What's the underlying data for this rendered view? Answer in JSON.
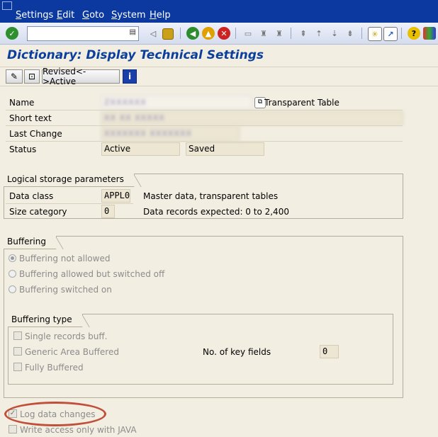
{
  "menu": {
    "items": [
      "Settings",
      "Edit",
      "Goto",
      "System",
      "Help"
    ],
    "accents": [
      "S",
      "E",
      "G",
      "S",
      "H"
    ]
  },
  "toolbar": {
    "command_field_value": "",
    "icons": [
      "enter-icon",
      "command-history-icon",
      "back-arrow-icon",
      "save-icon",
      "back-icon",
      "exit-icon",
      "cancel-icon",
      "print-icon",
      "find-icon",
      "find-next-icon",
      "first-page-icon",
      "previous-page-icon",
      "next-page-icon",
      "last-page-icon",
      "create-session-icon",
      "shortcut-icon",
      "help-icon",
      "layout-menu-icon"
    ]
  },
  "title": "Dictionary: Display Technical Settings",
  "app_toolbar": {
    "revised_active_label": "Revised<->Active",
    "info_label": "i"
  },
  "header_fields": {
    "name_label": "Name",
    "name_value": "ZXXXXXX",
    "table_type": "Transparent Table",
    "short_text_label": "Short text",
    "short_text_value": "XX XX XXXXX",
    "last_change_label": "Last Change",
    "last_change_value": "XXXXXXX   XXXXXXX",
    "status_label": "Status",
    "status_value": "Active",
    "status_saved": "Saved"
  },
  "storage": {
    "group_title": "Logical storage parameters",
    "data_class_label": "Data class",
    "data_class_value": "APPL0",
    "data_class_desc": "Master data, transparent tables",
    "size_category_label": "Size category",
    "size_category_value": "0",
    "size_category_desc": "Data records expected: 0 to 2,400"
  },
  "buffering": {
    "group_title": "Buffering",
    "options": [
      "Buffering not allowed",
      "Buffering allowed but switched off",
      "Buffering switched on"
    ],
    "selected_index": 0,
    "type_group_title": "Buffering type",
    "types": [
      "Single records buff.",
      "Generic Area Buffered",
      "Fully Buffered"
    ],
    "key_fields_label": "No. of key fields",
    "key_fields_value": "0"
  },
  "log": {
    "log_data_changes_label": "Log data changes",
    "log_data_changes_checked": true,
    "write_access_label": "Write access only with JAVA",
    "write_access_checked": false
  },
  "colors": {
    "menu_bar": "#0b39a0",
    "title": "#0b3f9e",
    "background": "#f2eee2",
    "highlight_circle": "#c0503a"
  }
}
